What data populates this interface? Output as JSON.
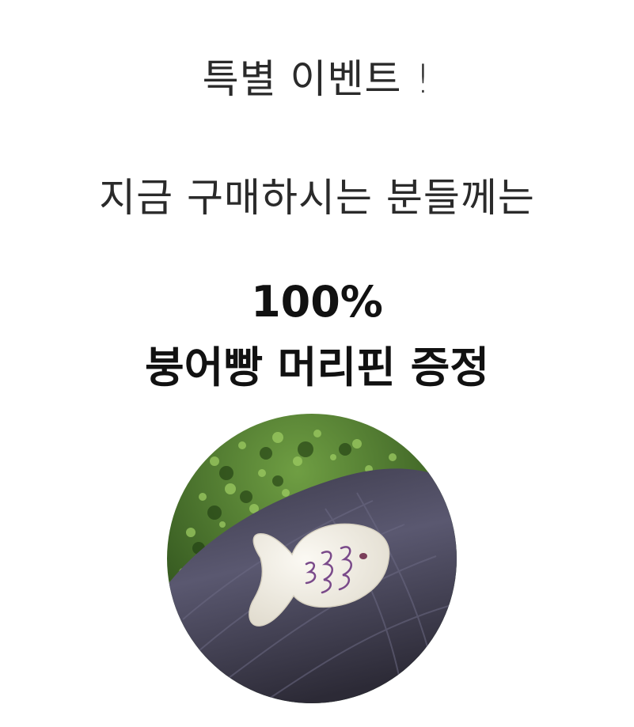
{
  "event": {
    "headline": "특별 이벤트 !",
    "subline": "지금 구매하시는 분들께는",
    "percent": "100%",
    "gift": "붕어빵 머리핀 증정"
  },
  "photo": {
    "subject": "fish-shaped hair pin on dark hair",
    "colors": {
      "foliage_dark": "#2f5a1e",
      "foliage_light": "#8fbf5a",
      "hair_dark": "#2e2c3a",
      "hair_mid": "#55536a",
      "pin_fill": "#f4f1ea",
      "pin_stitch": "#7a4a8a"
    }
  }
}
